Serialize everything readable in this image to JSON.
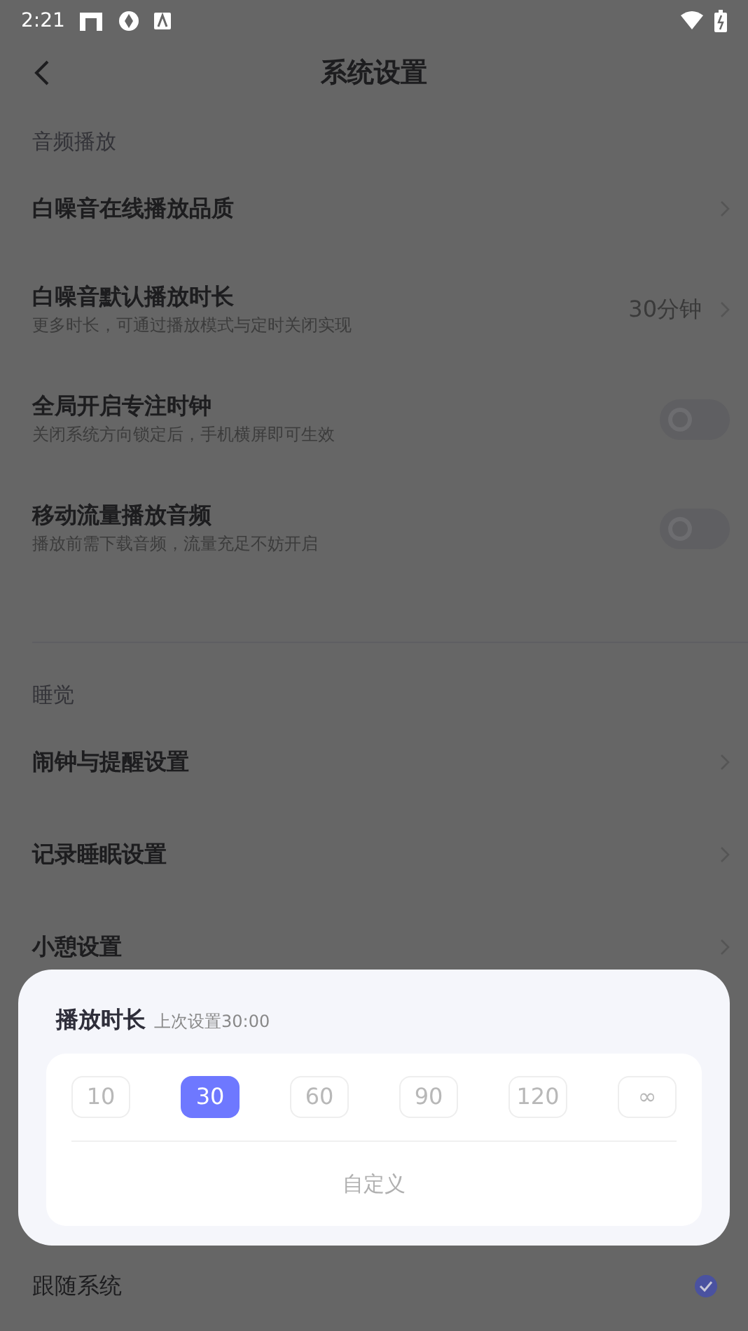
{
  "status_bar": {
    "time": "2:21"
  },
  "header": {
    "title": "系统设置"
  },
  "sections": [
    {
      "title": "音频播放",
      "items": [
        {
          "kind": "link",
          "label": "白噪音在线播放品质"
        },
        {
          "kind": "link",
          "label": "白噪音默认播放时长",
          "subtitle": "更多时长，可通过播放模式与定时关闭实现",
          "value": "30分钟"
        },
        {
          "kind": "toggle",
          "label": "全局开启专注时钟",
          "subtitle": "关闭系统方向锁定后，手机横屏即可生效",
          "on": false
        },
        {
          "kind": "toggle",
          "label": "移动流量播放音频",
          "subtitle": "播放前需下载音频，流量充足不妨开启",
          "on": false
        }
      ]
    },
    {
      "title": "睡觉",
      "items": [
        {
          "kind": "link",
          "label": "闹钟与提醒设置"
        },
        {
          "kind": "link",
          "label": "记录睡眠设置"
        },
        {
          "kind": "link",
          "label": "小憩设置"
        }
      ]
    }
  ],
  "dialog": {
    "title": "播放时长",
    "hint": "上次设置30:00",
    "options": [
      {
        "label": "10",
        "selected": false
      },
      {
        "label": "30",
        "selected": true
      },
      {
        "label": "60",
        "selected": false
      },
      {
        "label": "90",
        "selected": false
      },
      {
        "label": "120",
        "selected": false
      },
      {
        "label": "∞",
        "selected": false
      }
    ],
    "custom_button": "自定义"
  },
  "bottom_row": {
    "label": "跟随系统",
    "checked": true
  }
}
